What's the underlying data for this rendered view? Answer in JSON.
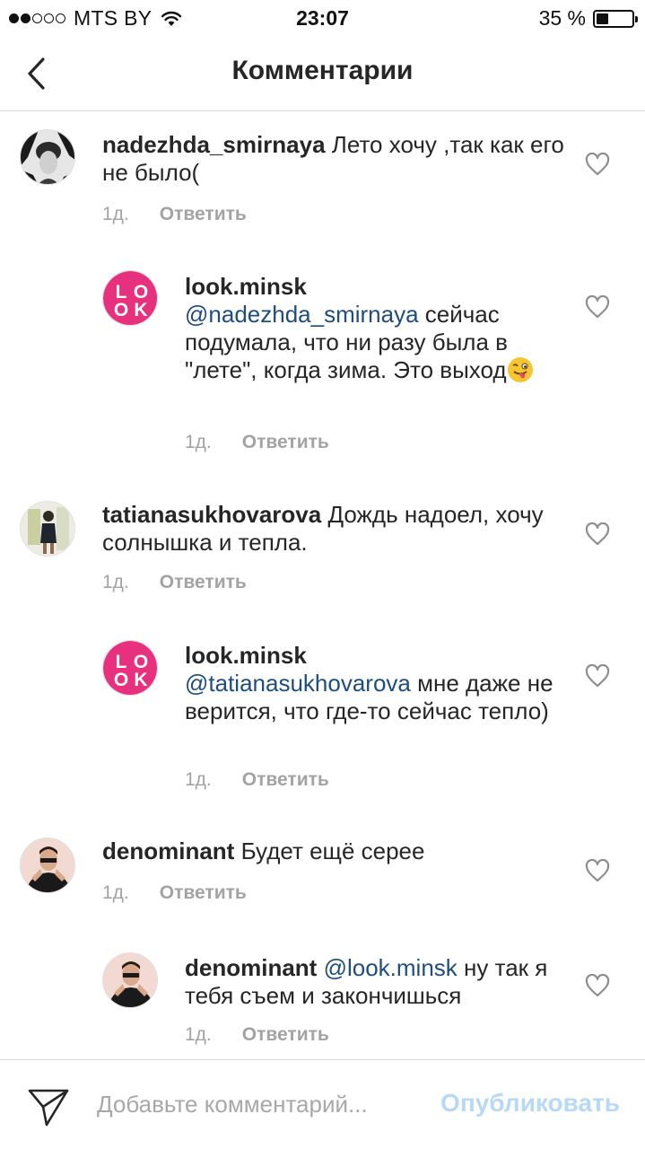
{
  "status_bar": {
    "carrier": "MTS BY",
    "time": "23:07",
    "battery_percent": "35 %",
    "battery_level": 0.35,
    "signal_filled": 2,
    "signal_total": 5
  },
  "nav": {
    "title": "Комментарии",
    "back_icon": "chevron-left-icon"
  },
  "comments": [
    {
      "username": "nadezhda_smirnaya",
      "text": " Лето хочу ,так как его не было(",
      "mention": "",
      "time": "1д.",
      "reply_label": "Ответить"
    },
    {
      "username": "look.minsk",
      "mention": "@nadezhda_smirnaya",
      "text": " сейчас подумала, что ни разу была в \"лете\", когда зима. Это выход",
      "emoji": "winking-tongue-emoji",
      "time": "1д.",
      "reply_label": "Ответить"
    },
    {
      "username": "tatianasukhovarova",
      "text": " Дождь надоел, хочу солнышка и тепла.",
      "mention": "",
      "time": "1д.",
      "reply_label": "Ответить"
    },
    {
      "username": "look.minsk",
      "mention": "@tatianasukhovarova",
      "text": " мне даже не верится, что где-то сейчас тепло)",
      "time": "1д.",
      "reply_label": "Ответить"
    },
    {
      "username": "denominant",
      "text": " Будет ещё серее",
      "mention": "",
      "time": "1д.",
      "reply_label": "Ответить"
    },
    {
      "username": "denominant",
      "mention": "@look.minsk",
      "text": " ну так я тебя съем и закончишься",
      "time": "1д.",
      "reply_label": "Ответить"
    }
  ],
  "look_logo": {
    "l": "L",
    "o1": "O",
    "o2": "O",
    "k": "K",
    "color": "#e8317e"
  },
  "compose": {
    "placeholder": "Добавьте комментарий...",
    "publish_label": "Опубликовать",
    "publish_color": "#b6d9f7"
  },
  "colors": {
    "mention": "#1e4d7f",
    "meta": "#a3a3a3",
    "divider": "#dbdbdb"
  }
}
